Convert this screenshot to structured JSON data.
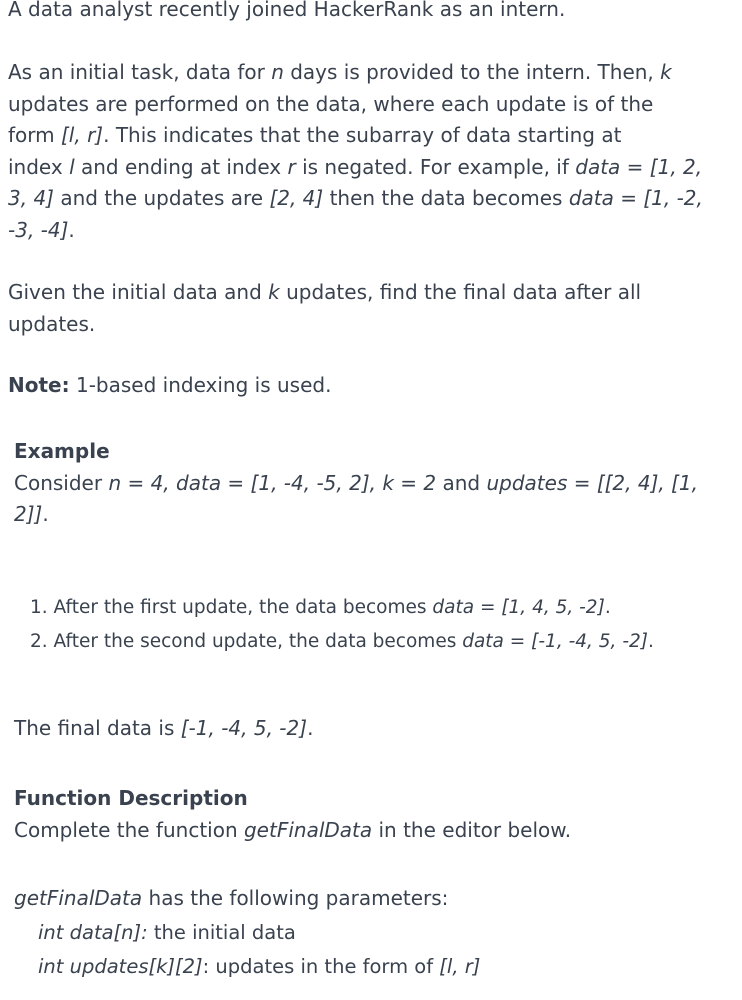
{
  "intro": {
    "line1": "A data analyst recently joined HackerRank as an intern."
  },
  "task": {
    "l1_a": "As an initial task, data for ",
    "l1_n": "n",
    "l1_b": " days is provided to the intern. Then, ",
    "l1_k": "k",
    "l2": "updates are performed on the data, where each update is of the",
    "l3_a": "form ",
    "l3_lr": "[l, r]",
    "l3_b": ". This indicates that the subarray of data starting at",
    "l4_a": "index ",
    "l4_l": "l",
    "l4_b": " and ending at index ",
    "l4_r": "r",
    "l4_c": " is negated. For example, if ",
    "l4_data": "data = [1, 2,",
    "l5_data": "3, 4]",
    "l5_a": " and the updates are ",
    "l5_upd": "[2, 4]",
    "l5_b": " then the data becomes ",
    "l5_res": "data = [1, -2,",
    "l6_res": "-3, -4]",
    "l6_end": "."
  },
  "given": {
    "l1_a": "Given the initial data and ",
    "l1_k": "k",
    "l1_b": " updates, find the final data after all",
    "l2": "updates."
  },
  "note": {
    "label": "Note:",
    "text": " 1-based indexing is used."
  },
  "example": {
    "heading": "Example",
    "l1_a": "Consider ",
    "l1_n": "n = 4, data = [1, -4, -5, 2], k = 2",
    "l1_b": " and ",
    "l1_upd": "updates = [[2, 4], [1,",
    "l2_upd": "2]]",
    "l2_end": ".",
    "steps": [
      {
        "num": "1.",
        "text": " After the first update, the data becomes ",
        "value": "data = [1, 4, 5, -2]",
        "end": "."
      },
      {
        "num": "2.",
        "text": " After the second update, the data becomes ",
        "value": "data = [-1, -4, 5, -2]",
        "end": "."
      }
    ],
    "final_a": "The final data is ",
    "final_val": "[-1, -4, 5, -2]",
    "final_end": "."
  },
  "function": {
    "heading": "Function Description",
    "l1_a": "Complete the function ",
    "l1_name": "getFinalData",
    "l1_b": " in the editor below.",
    "params_name": "getFinalData",
    "params_text": " has the following parameters:",
    "params": [
      {
        "sig": "int data[n]:",
        "desc": " the initial data"
      },
      {
        "sig": "int updates[k][2]",
        "desc": ": updates in the form of ",
        "tail": "[l, r]"
      }
    ]
  }
}
